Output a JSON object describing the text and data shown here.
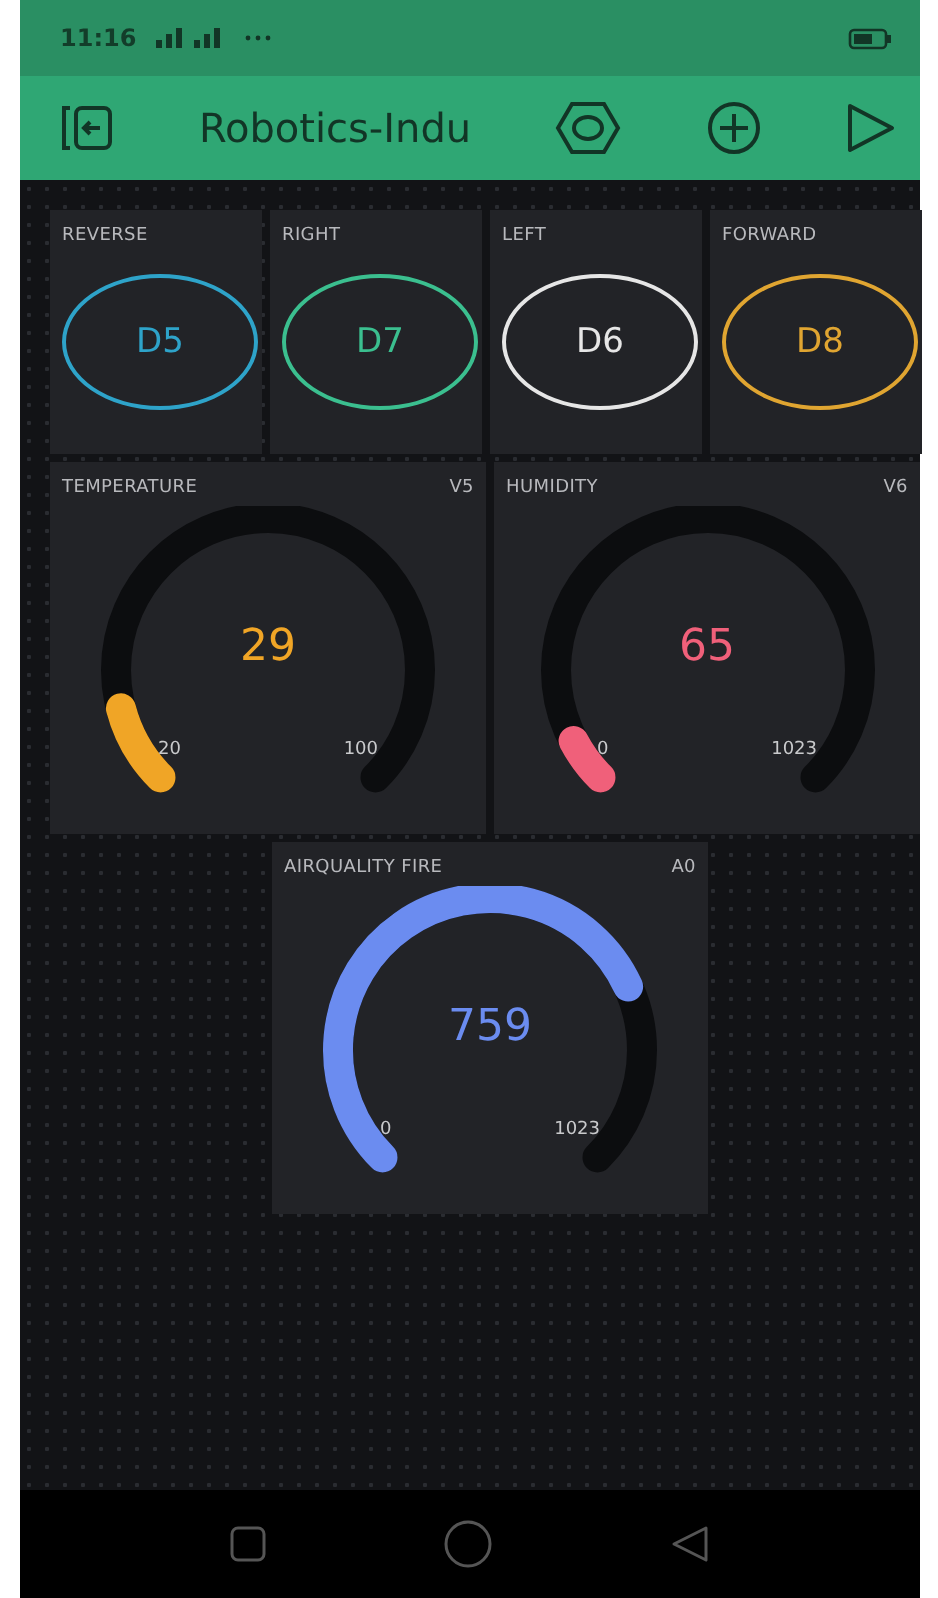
{
  "status_bar": {
    "time": "11:16"
  },
  "header": {
    "title": "Robotics-Indu"
  },
  "buttons": [
    {
      "label": "REVERSE",
      "pin": "D5",
      "color": "#2ea3c9"
    },
    {
      "label": "RIGHT",
      "pin": "D7",
      "color": "#3bbf8f"
    },
    {
      "label": "LEFT",
      "pin": "D6",
      "color": "#e6e6e6"
    },
    {
      "label": "FORWARD",
      "pin": "D8",
      "color": "#e0a531"
    }
  ],
  "gauges": [
    {
      "label": "TEMPERATURE",
      "pin": "V5",
      "value": "29",
      "min": "20",
      "max": "100",
      "color": "#f0a526"
    },
    {
      "label": "HUMIDITY",
      "pin": "V6",
      "value": "65",
      "min": "0",
      "max": "1023",
      "color": "#f0607a"
    },
    {
      "label": "AIRQUALITY FIRE",
      "pin": "A0",
      "value": "759",
      "min": "0",
      "max": "1023",
      "color": "#6b8cf0"
    }
  ]
}
